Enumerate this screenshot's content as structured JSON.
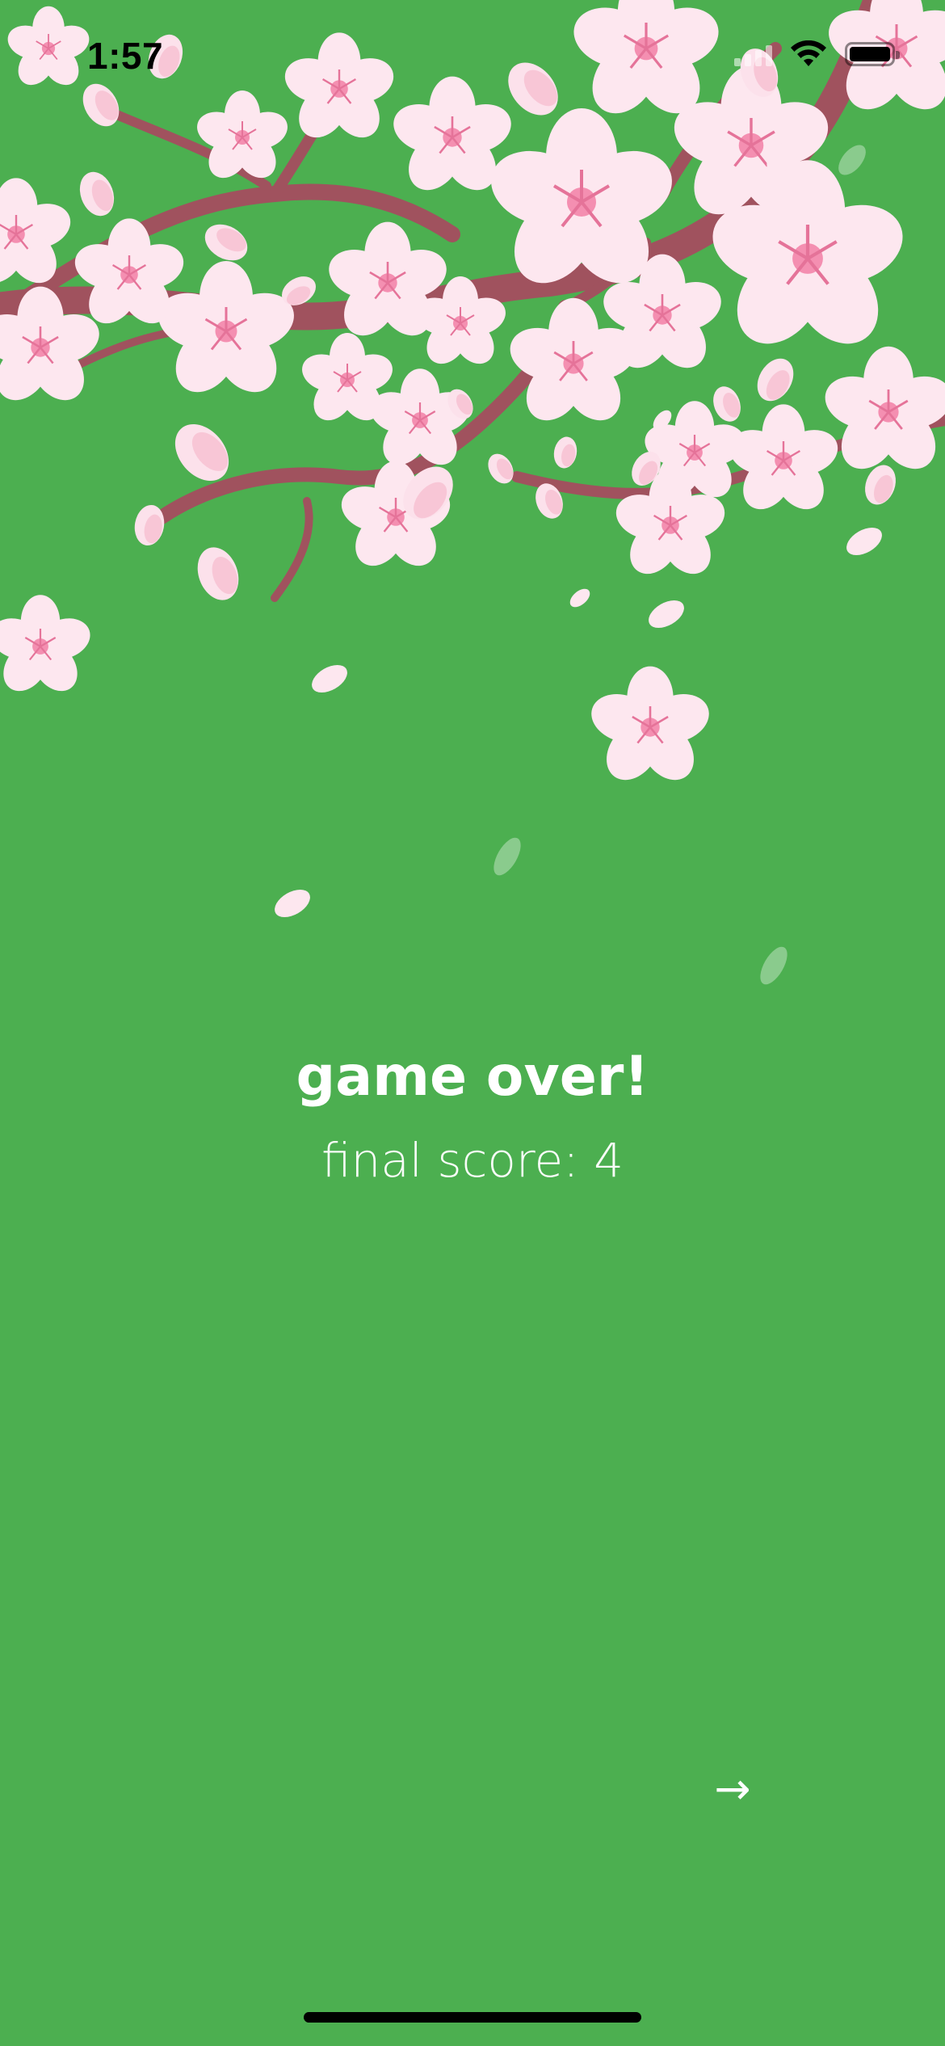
{
  "status_bar": {
    "time": "1:57",
    "signal_bars_filled": 0,
    "wifi": "wifi-icon",
    "battery_level": 1.0
  },
  "game": {
    "title": "game over!",
    "score_text": "final score: 4",
    "next_button_label": "→"
  },
  "colors": {
    "background": "#4caf50",
    "petal": "#fce4ec",
    "petal_center": "#f48fb1",
    "branch": "#a0525e",
    "text": "#ffffff"
  }
}
